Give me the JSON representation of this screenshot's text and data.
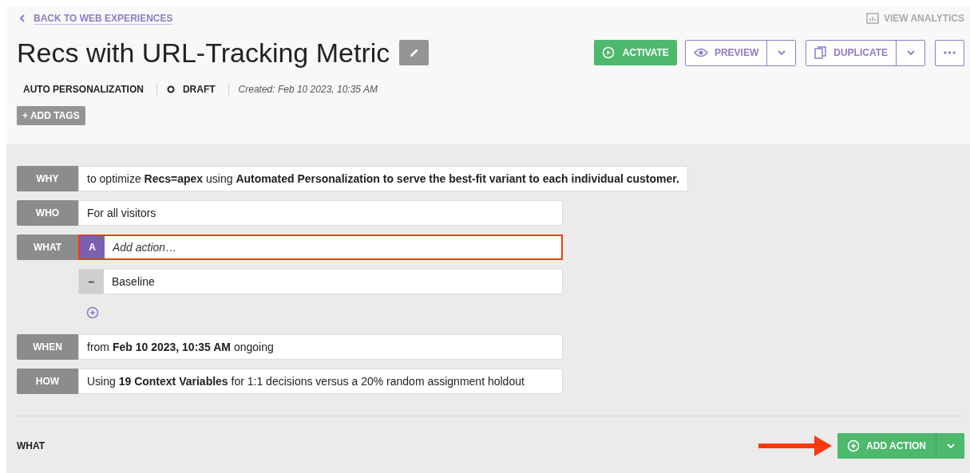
{
  "back_link": "BACK TO WEB EXPERIENCES",
  "view_analytics": {
    "label": "VIEW ANALYTICS",
    "disabled": true
  },
  "title": "Recs with URL-Tracking Metric",
  "buttons": {
    "activate": "ACTIVATE",
    "preview": "PREVIEW",
    "duplicate": "DUPLICATE"
  },
  "meta": {
    "type": "AUTO PERSONALIZATION",
    "status": "DRAFT",
    "created": "Created: Feb 10 2023, 10:35 AM"
  },
  "add_tags": "+ ADD TAGS",
  "rows": [
    {
      "kind": "statement",
      "label": "WHY",
      "text": "to optimize **Recs=apex** using **Automated Personalization to serve the best-fit variant to each individual customer.**"
    },
    {
      "kind": "statement",
      "label": "WHO",
      "text": "For all visitors"
    },
    {
      "kind": "action",
      "label": "WHAT",
      "badge": "A",
      "placeholder": "Add action…",
      "highlighted": true
    },
    {
      "kind": "variant",
      "badge": "–",
      "text": "Baseline"
    },
    {
      "kind": "add"
    },
    {
      "kind": "statement",
      "label": "WHEN",
      "text": "from **Feb 10 2023, 10:35 AM** ongoing"
    },
    {
      "kind": "statement",
      "label": "HOW",
      "text": "Using **19 Context Variables** for 1:1 decisions versus a 20% random assignment holdout"
    }
  ],
  "footer": {
    "label": "WHAT",
    "button": "ADD ACTION",
    "arrow": true
  }
}
